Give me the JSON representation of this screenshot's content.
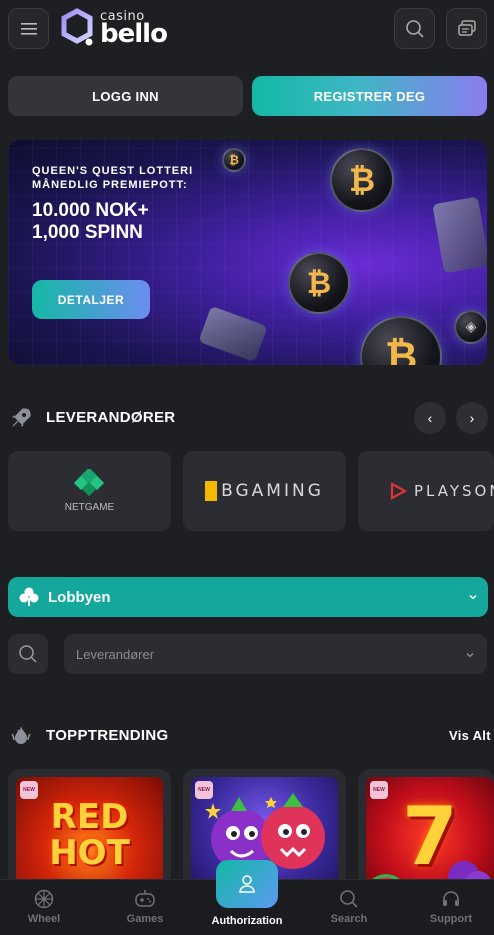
{
  "header": {
    "logo_small": "casino",
    "logo_big": "bello",
    "menu_icon": "hamburger-icon",
    "search_icon": "search-icon",
    "chat_icon": "chat-icon"
  },
  "auth": {
    "login_label": "LOGG INN",
    "register_label": "REGISTRER DEG"
  },
  "banner": {
    "kicker": "QUEEN'S QUEST LOTTERI MÅNEDLIG PREMIEPOTT:",
    "title_line1": "10.000 NOK+",
    "title_line2": "1,000 SPINN",
    "button_label": "DETALJER"
  },
  "providers": {
    "title": "LEVERANDØRER",
    "items": [
      {
        "name": "NETGAME"
      },
      {
        "name": "BGAMING"
      },
      {
        "name": "PLAYSON"
      }
    ]
  },
  "lobby": {
    "label": "Lobbyen"
  },
  "filter": {
    "provider_placeholder": "Leverandører"
  },
  "trending": {
    "title": "TOPPTRENDING",
    "view_all": "Vis Alt",
    "games": [
      {
        "badge": "NEW",
        "art_text_1": "RED",
        "art_text_2": "HOT"
      },
      {
        "badge": "NEW"
      },
      {
        "badge": "NEW",
        "art_text_1": "7"
      }
    ]
  },
  "nav": {
    "items": [
      {
        "label": "Wheel"
      },
      {
        "label": "Games"
      },
      {
        "label": "Authorization"
      },
      {
        "label": "Search"
      },
      {
        "label": "Support"
      }
    ]
  },
  "colors": {
    "background": "#1e1f23",
    "accent": "#14a79b",
    "card": "#2c2d32"
  }
}
